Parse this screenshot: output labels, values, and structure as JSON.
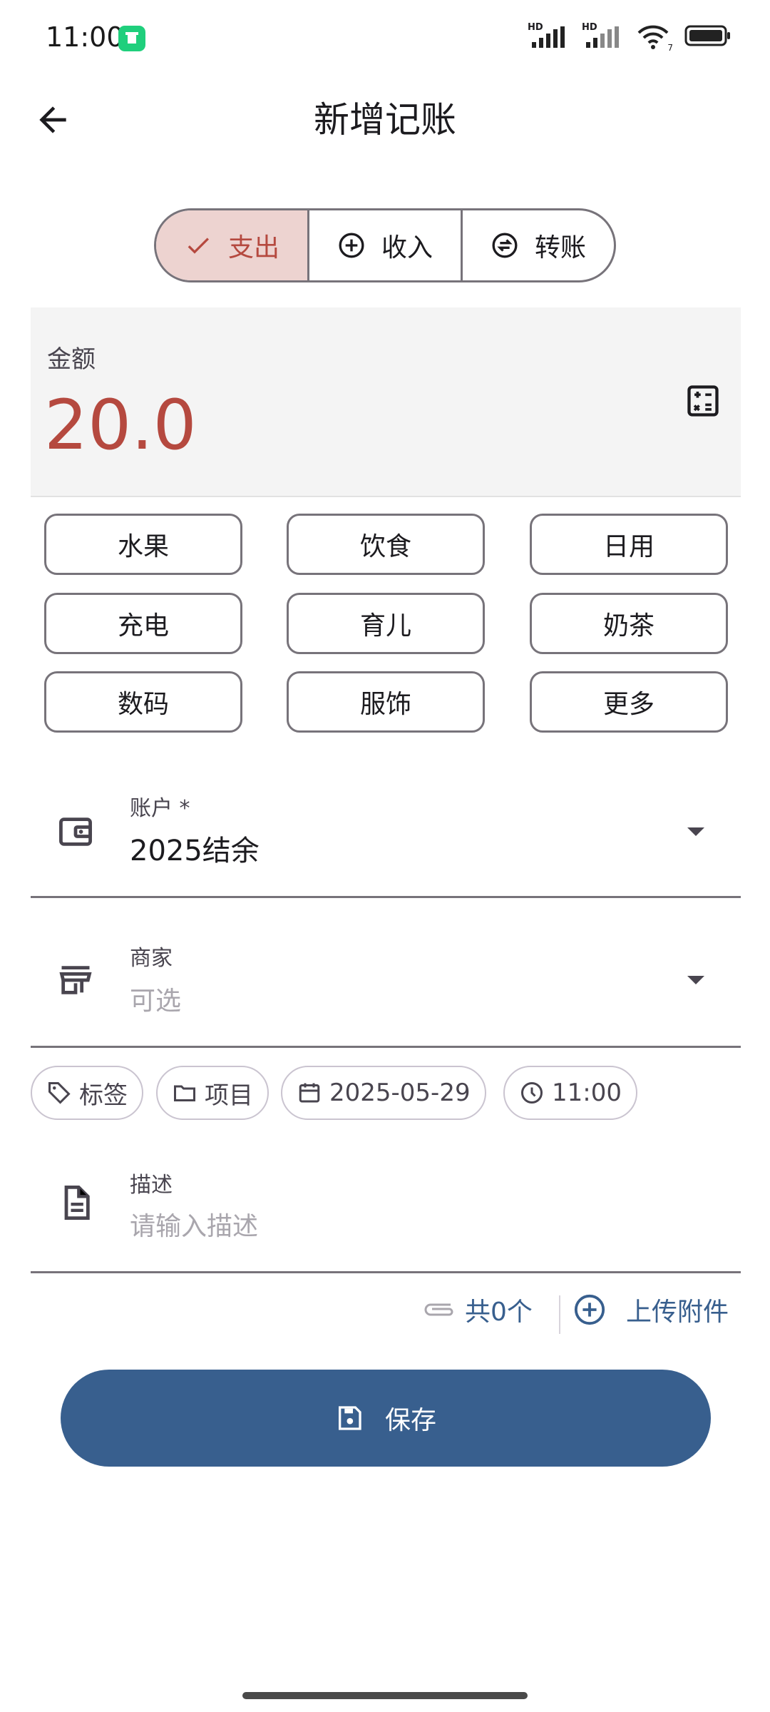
{
  "status": {
    "time": "11:00",
    "hd1": "HD",
    "hd2": "HD",
    "wifi_label": "7"
  },
  "header": {
    "title": "新增记账",
    "back_icon": "arrow-left-icon"
  },
  "type_tabs": [
    {
      "label": "支出",
      "icon": "check-icon",
      "selected": true
    },
    {
      "label": "收入",
      "icon": "plus-circle-icon",
      "selected": false
    },
    {
      "label": "转账",
      "icon": "swap-circle-icon",
      "selected": false
    }
  ],
  "amount": {
    "label": "金额",
    "value": "20.0",
    "icon": "calculator-icon"
  },
  "categories": [
    "水果",
    "饮食",
    "日用",
    "充电",
    "育儿",
    "奶茶",
    "数码",
    "服饰",
    "更多"
  ],
  "account": {
    "label": "账户 *",
    "value": "2025结余",
    "icon": "wallet-icon"
  },
  "merchant": {
    "label": "商家",
    "placeholder": "可选",
    "icon": "store-icon"
  },
  "pills": [
    {
      "label": "标签",
      "icon": "tag-icon"
    },
    {
      "label": "项目",
      "icon": "folder-icon"
    },
    {
      "label": "2025-05-29",
      "icon": "calendar-icon"
    },
    {
      "label": "11:00",
      "icon": "clock-icon"
    }
  ],
  "description": {
    "label": "描述",
    "placeholder": "请输入描述",
    "icon": "document-icon"
  },
  "attachments": {
    "count_label": "共0个",
    "upload_label": "上传附件"
  },
  "save": {
    "label": "保存",
    "icon": "save-icon"
  },
  "colors": {
    "accent": "#b5493f",
    "primary": "#385f8e",
    "selected_bg": "#edd3d0"
  }
}
